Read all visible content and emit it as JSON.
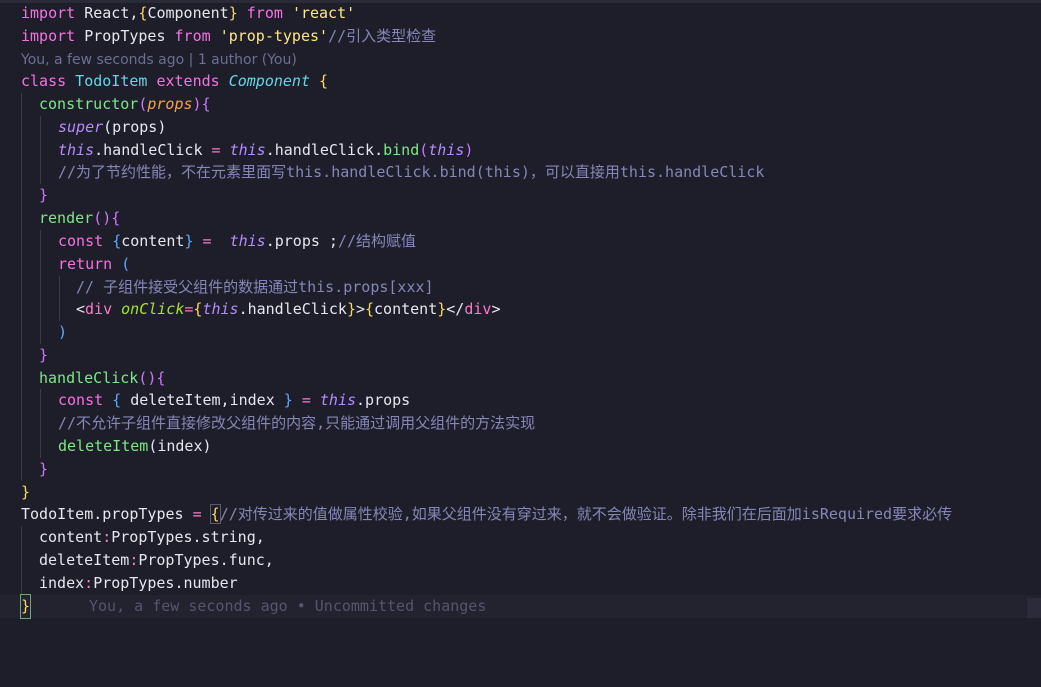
{
  "editor": {
    "blame_header": "You, a few seconds ago | 1 author (You)",
    "inline_blame": "You, a few seconds ago • Uncommitted changes",
    "lines": {
      "l1": {
        "t1": "import",
        "t2": " React,",
        "t3": "{",
        "t4": "Component",
        "t5": "}",
        "t6": " from ",
        "t7": "'react'"
      },
      "l2": {
        "t1": "import",
        "t2": " PropTypes ",
        "t3": "from",
        "t4": " ",
        "t5": "'prop-types'",
        "t6": "//引入类型检查"
      },
      "l3": {
        "t1": "class",
        "t2": " TodoItem ",
        "t3": "extends",
        "t4": " ",
        "t5": "Component",
        "t6": " ",
        "t7": "{"
      },
      "l4": {
        "t1": "constructor",
        "t2": "(",
        "t3": "props",
        "t4": "){"
      },
      "l5": {
        "t1": "super",
        "t2": "(props)"
      },
      "l6": {
        "t1": "this",
        "t2": ".handleClick ",
        "t3": "=",
        "t4": " ",
        "t5": "this",
        "t6": ".handleClick.",
        "t7": "bind",
        "t8": "(",
        "t9": "this",
        "t10": ")"
      },
      "l7": {
        "t1": "//为了节约性能，不在元素里面写this.handleClick.bind(this)，可以直接用this.handleClick"
      },
      "l8": {
        "t1": "}"
      },
      "l9": {
        "t1": "render",
        "t2": "(){"
      },
      "l10": {
        "t1": "const",
        "t2": " ",
        "t3": "{",
        "t4": "content",
        "t5": "}",
        "t6": " = ",
        "t7": " this",
        "t8": ".props ;",
        "t9": "//结构赋值"
      },
      "l11": {
        "t1": "return",
        "t2": " ("
      },
      "l12": {
        "t1": "// 子组件接受父组件的数据通过this.props[xxx]"
      },
      "l13": {
        "t1": "<",
        "t2": "div",
        "t3": " ",
        "t4": "onClick",
        "t5": "=",
        "t6": "{",
        "t7": "this",
        "t8": ".handleClick",
        "t9": "}",
        "t10": ">",
        "t11": "{",
        "t12": "content",
        "t13": "}",
        "t14": "</",
        "t15": "div",
        "t16": ">"
      },
      "l14": {
        "t1": ")"
      },
      "l15": {
        "t1": "}"
      },
      "l16": {
        "t1": "handleClick",
        "t2": "(){"
      },
      "l17": {
        "t1": "const",
        "t2": " { ",
        "t3": "deleteItem,index",
        "t4": " } ",
        "t5": "=",
        "t6": " ",
        "t7": "this",
        "t8": ".props"
      },
      "l18": {
        "t1": "//不允许子组件直接修改父组件的内容,只能通过调用父组件的方法实现"
      },
      "l19": {
        "t1": "deleteItem",
        "t2": "(index)"
      },
      "l20": {
        "t1": "}"
      },
      "l21": {
        "t1": "}"
      },
      "l22": {
        "t1": "TodoItem.propTypes ",
        "t2": "=",
        "t3": " ",
        "t4": "{",
        "t5": "//对传过来的值做属性校验,如果父组件没有穿过来，就不会做验证。除非我们在后面加isRequired要求必传"
      },
      "l23": {
        "t1": "content",
        "t2": ":",
        "t3": "PropTypes.string,"
      },
      "l24": {
        "t1": "deleteItem",
        "t2": ":",
        "t3": "PropTypes.func,"
      },
      "l25": {
        "t1": "index",
        "t2": ":",
        "t3": "PropTypes.number"
      },
      "l26": {
        "t1": "}"
      }
    }
  },
  "colors": {
    "background": "#1e1e2a",
    "keyword": "#f472e0",
    "class_name": "#62d6e8",
    "function": "#7ee787",
    "string": "#ffe680",
    "comment": "#8686b8",
    "this_keyword": "#b48cff",
    "parameter": "#f5a14b"
  }
}
